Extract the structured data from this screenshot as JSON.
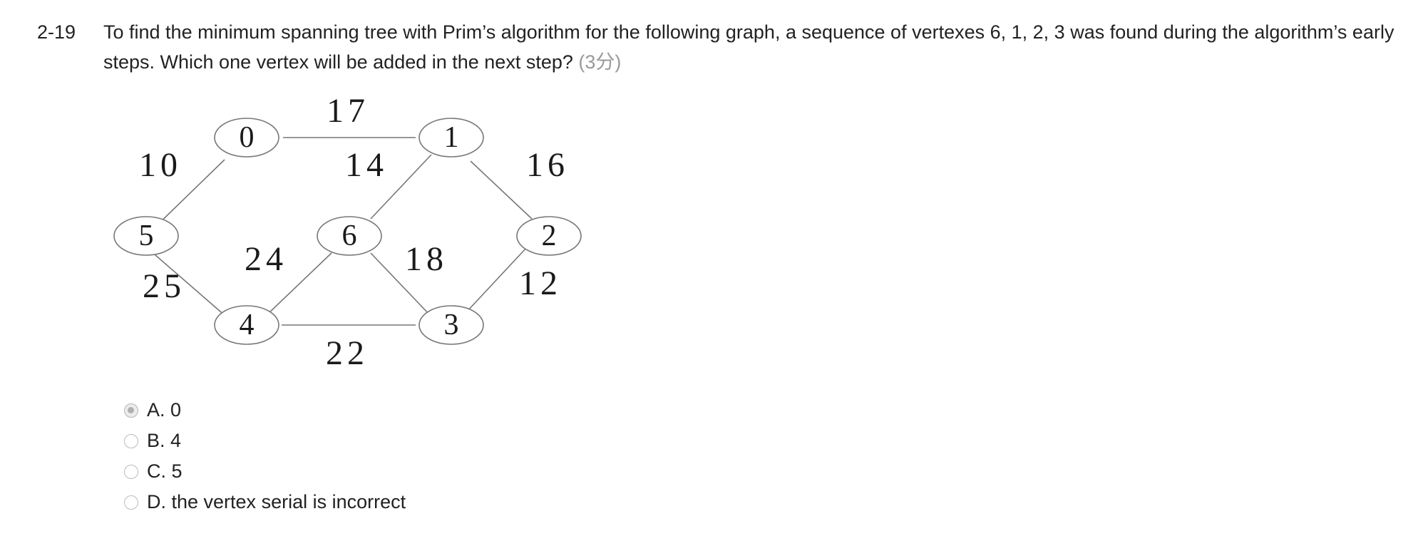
{
  "question": {
    "number": "2-19",
    "text": "To find the minimum spanning tree with Prim’s algorithm for the following graph, a sequence of vertexes 6, 1, 2, 3 was found during the algorithm’s early steps. Which one vertex will be added in the next step?",
    "score": "(3分)"
  },
  "graph": {
    "nodes": [
      "0",
      "1",
      "2",
      "3",
      "4",
      "5",
      "6"
    ],
    "edges": [
      {
        "from": "0",
        "to": "1",
        "weight": "17"
      },
      {
        "from": "0",
        "to": "5",
        "weight": "10"
      },
      {
        "from": "1",
        "to": "6",
        "weight": "14"
      },
      {
        "from": "1",
        "to": "2",
        "weight": "16"
      },
      {
        "from": "5",
        "to": "4",
        "weight": "25"
      },
      {
        "from": "6",
        "to": "4",
        "weight": "24"
      },
      {
        "from": "6",
        "to": "3",
        "weight": "18"
      },
      {
        "from": "2",
        "to": "3",
        "weight": "12"
      },
      {
        "from": "4",
        "to": "3",
        "weight": "22"
      }
    ]
  },
  "options": [
    {
      "label": "A. 0",
      "selected": true
    },
    {
      "label": "B. 4",
      "selected": false
    },
    {
      "label": "C. 5",
      "selected": false
    },
    {
      "label": "D. the vertex serial is incorrect",
      "selected": false
    }
  ]
}
